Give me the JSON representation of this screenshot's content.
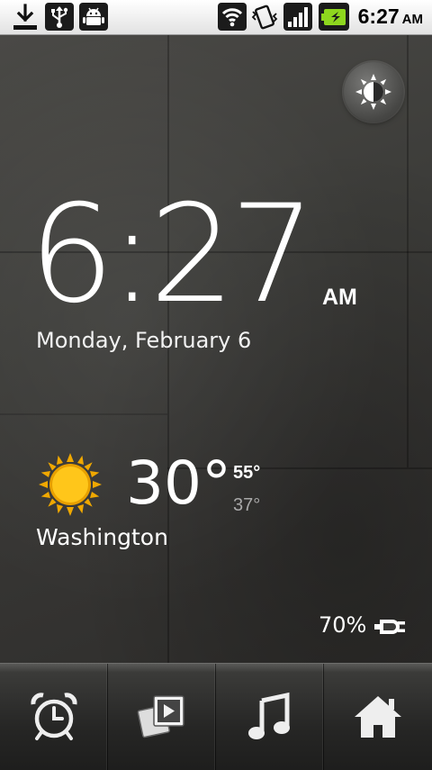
{
  "status_bar": {
    "icons": [
      "download-icon",
      "usb-icon",
      "android-debug-icon",
      "wifi-icon",
      "vibrate-icon",
      "signal-icon",
      "battery-charging-icon"
    ],
    "time": "6:27",
    "ampm": "AM"
  },
  "brightness_button": {
    "icon": "brightness-icon"
  },
  "clock": {
    "time": "6:27",
    "ampm": "AM",
    "date": "Monday, February 6"
  },
  "weather": {
    "condition_icon": "sun-icon",
    "temperature": "30°",
    "high": "55°",
    "low": "37°",
    "city": "Washington"
  },
  "battery": {
    "percent": "70%",
    "icon": "charging-plug-icon"
  },
  "dock": {
    "items": [
      {
        "icon": "alarm-clock-icon"
      },
      {
        "icon": "slideshow-icon"
      },
      {
        "icon": "music-icon"
      },
      {
        "icon": "home-icon"
      }
    ]
  },
  "colors": {
    "status_bar_bg": "#f2f2f2",
    "battery_green": "#8ed61e",
    "sun_yellow": "#ffc61a",
    "text_white": "#ffffff",
    "text_gray": "#a9a9a9"
  }
}
